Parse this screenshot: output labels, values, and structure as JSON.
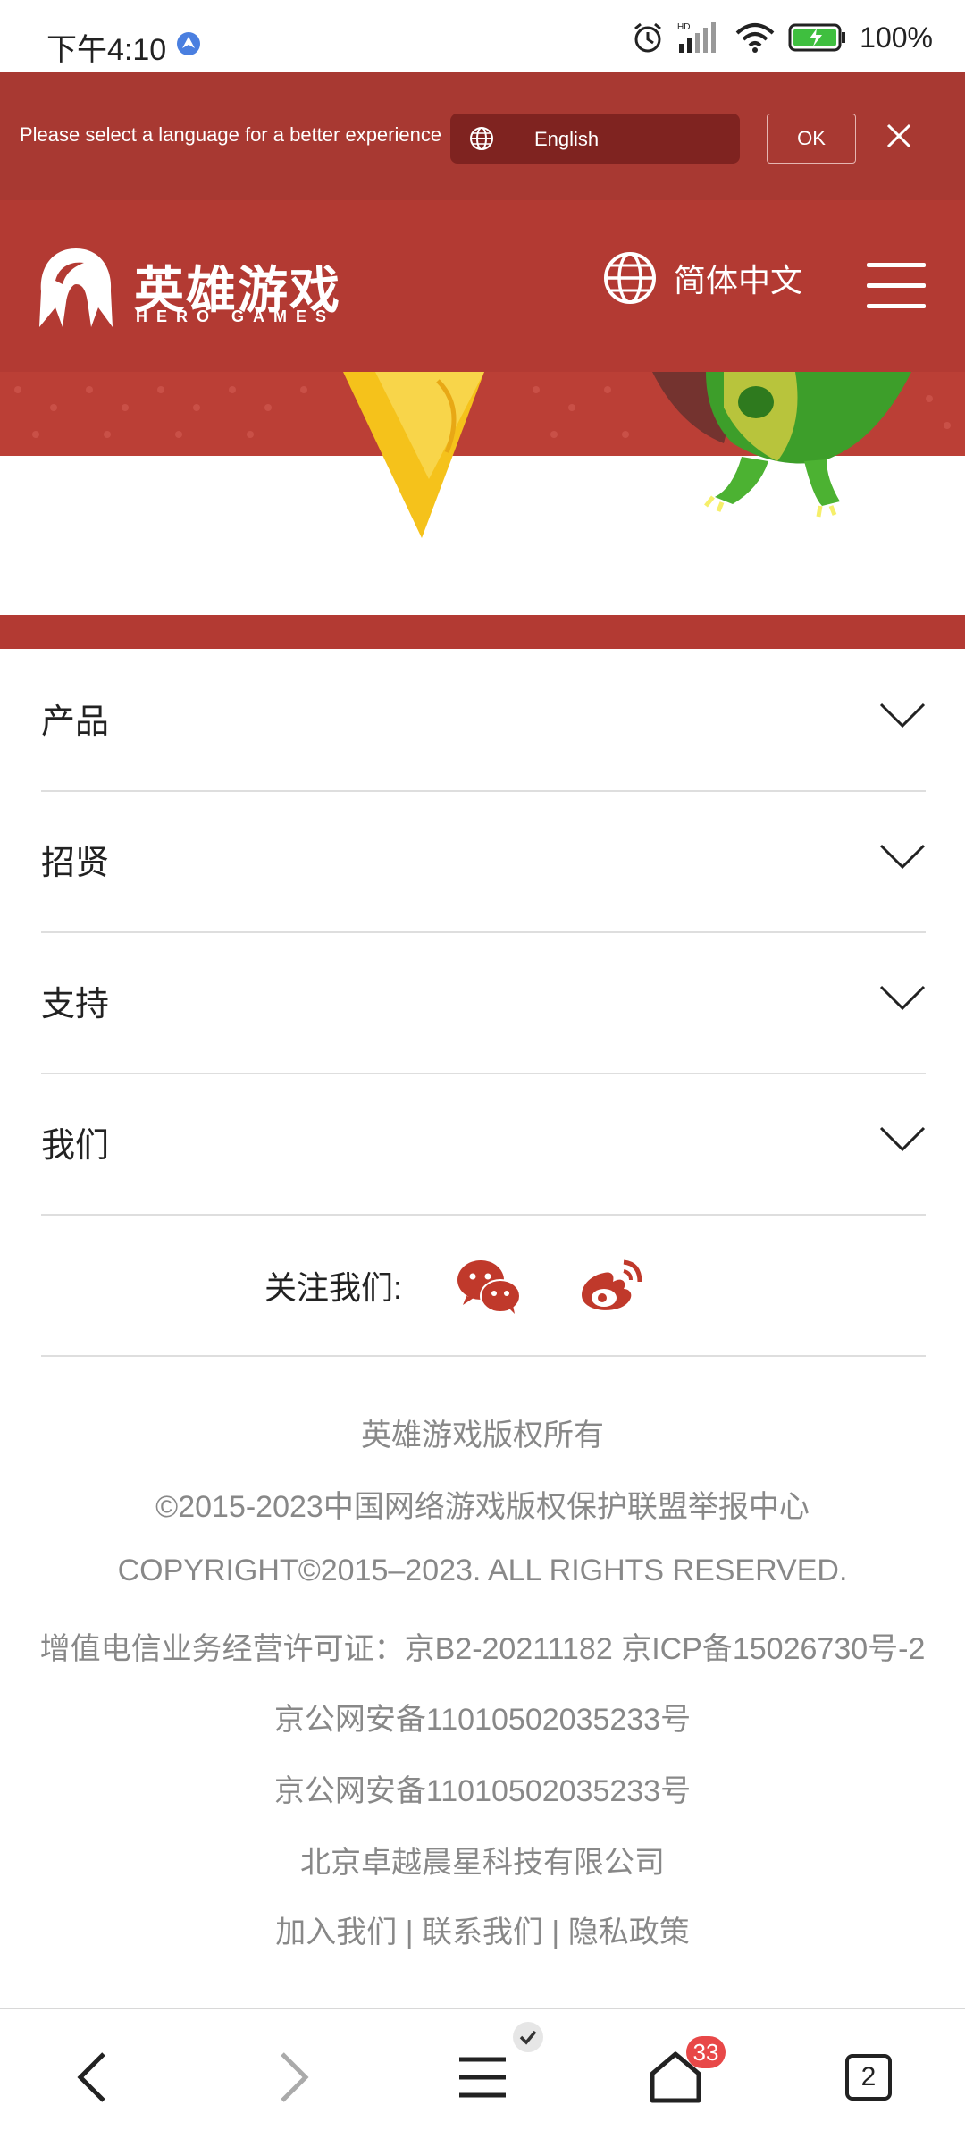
{
  "status_bar": {
    "time": "下午4:10",
    "battery": "100%"
  },
  "language_banner": {
    "message": "Please select a language for a better experience",
    "selected_language": "English",
    "ok_label": "OK"
  },
  "header": {
    "logo_cn": "英雄游戏",
    "logo_en": "HERO GAMES",
    "language_switch": "简体中文"
  },
  "accordion": [
    {
      "label": "产品"
    },
    {
      "label": "招贤"
    },
    {
      "label": "支持"
    },
    {
      "label": "我们"
    }
  ],
  "follow": {
    "label": "关注我们:"
  },
  "footer": {
    "lines": [
      "英雄游戏版权所有",
      "©2015-2023中国网络游戏版权保护联盟举报中心",
      "COPYRIGHT©2015–2023. ALL RIGHTS RESERVED.",
      "增值电信业务经营许可证：京B2-20211182 京ICP备15026730号-2",
      "京公网安备11010502035233号",
      "京公网安备11010502035233号",
      "北京卓越晨星科技有限公司",
      "加入我们 | 联系我们 | 隐私政策"
    ]
  },
  "bottom_nav": {
    "home_badge": "33",
    "tab_count": "2"
  },
  "colors": {
    "brand_red": "#b33a33",
    "banner_red": "#a83932",
    "badge_red": "#e84848"
  }
}
